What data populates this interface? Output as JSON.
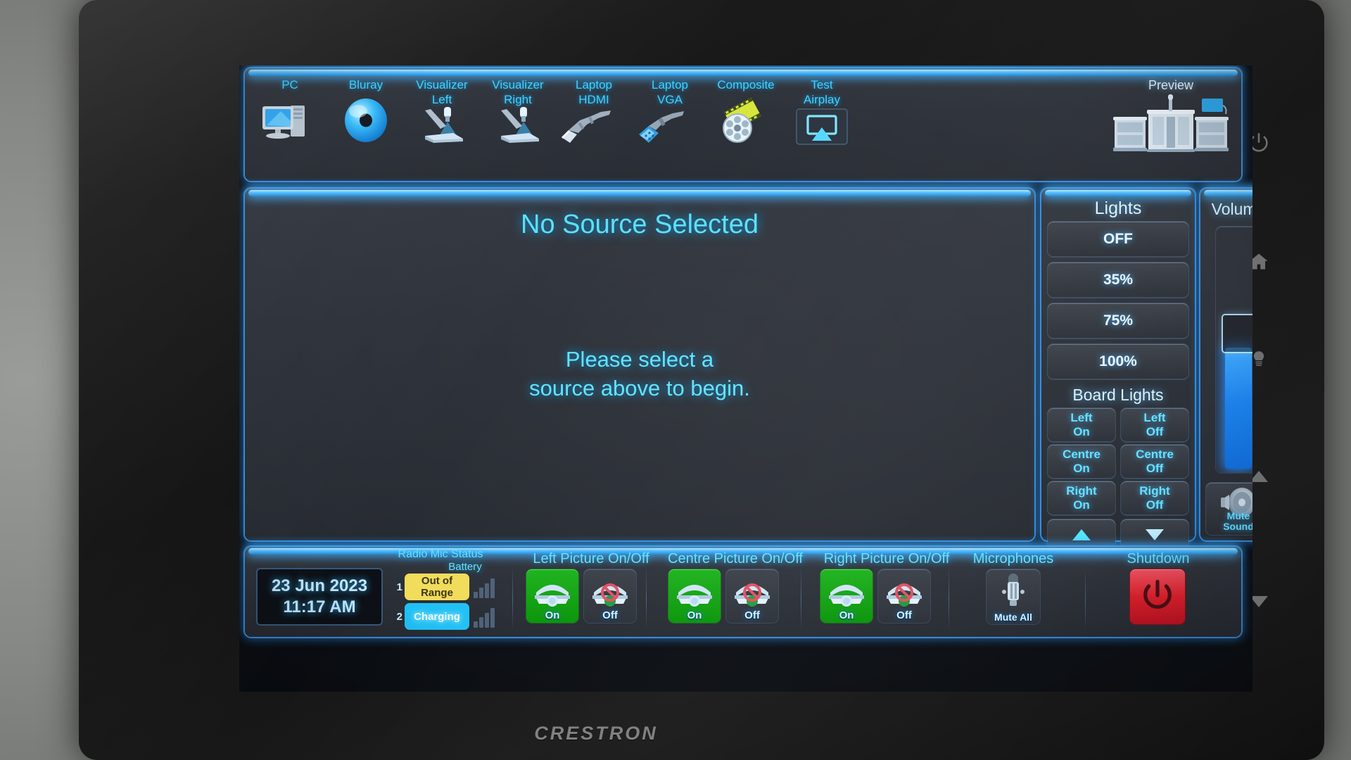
{
  "device": {
    "brand": "CRESTRON"
  },
  "hardware_buttons": [
    {
      "name": "power",
      "icon": "power-icon"
    },
    {
      "name": "home",
      "icon": "home-icon"
    },
    {
      "name": "lights",
      "icon": "lightbulb-icon"
    },
    {
      "name": "volume-up",
      "icon": "triangle-up-icon"
    },
    {
      "name": "volume-down",
      "icon": "triangle-down-icon"
    }
  ],
  "source_bar": {
    "sources": [
      {
        "label": "PC",
        "label2": "",
        "icon": "desktop-computer-icon"
      },
      {
        "label": "Bluray",
        "label2": "",
        "icon": "optical-disc-icon"
      },
      {
        "label": "Visualizer",
        "label2": "Left",
        "icon": "document-camera-icon"
      },
      {
        "label": "Visualizer",
        "label2": "Right",
        "icon": "document-camera-icon"
      },
      {
        "label": "Laptop",
        "label2": "HDMI",
        "icon": "hdmi-cable-icon"
      },
      {
        "label": "Laptop",
        "label2": "VGA",
        "icon": "vga-cable-icon"
      },
      {
        "label": "Composite",
        "label2": "",
        "icon": "film-reel-icon"
      },
      {
        "label": "Test",
        "label2": "Airplay",
        "icon": "airplay-icon"
      }
    ],
    "preview": {
      "label": "Preview",
      "icon": "lectern-preview-icon"
    }
  },
  "main_display": {
    "heading": "No Source Selected",
    "message_line1": "Please select a",
    "message_line2": "source above to begin."
  },
  "lights": {
    "title": "Lights",
    "levels": [
      "OFF",
      "35%",
      "75%",
      "100%"
    ],
    "board_title": "Board Lights",
    "board_buttons": [
      {
        "on": "Left\nOn",
        "off": "Left\nOff"
      },
      {
        "on": "Centre\nOn",
        "off": "Centre\nOff"
      },
      {
        "on": "Right\nOn",
        "off": "Right\nOff"
      }
    ],
    "board_rows": [
      {
        "on_l1": "Left",
        "on_l2": "On",
        "off_l1": "Left",
        "off_l2": "Off"
      },
      {
        "on_l1": "Centre",
        "on_l2": "On",
        "off_l1": "Centre",
        "off_l2": "Off"
      },
      {
        "on_l1": "Right",
        "on_l2": "On",
        "off_l1": "Right",
        "off_l2": "Off"
      }
    ],
    "raise_icon": "triangle-up-icon",
    "lower_icon": "triangle-down-icon"
  },
  "volume": {
    "title": "Volume",
    "level_percent": 48,
    "mute_line1": "Mute",
    "mute_line2": "Sound",
    "mute_icon": "speaker-icon",
    "fill_color": "#1a82f0"
  },
  "bottom_bar": {
    "clock": {
      "date": "23 Jun 2023",
      "time": "11:17 AM"
    },
    "radio_mic": {
      "title": "Radio Mic Status",
      "battery_label": "Battery",
      "channels": [
        {
          "number": "1",
          "status": "Out of Range",
          "status_line1": "Out of",
          "status_line2": "Range",
          "bg_color": "#f2dc5a",
          "text_color": "#3a3412",
          "battery_bars": 4
        },
        {
          "number": "2",
          "status": "Charging",
          "status_line1": "Charging",
          "status_line2": "",
          "bg_color": "#1fc0f5",
          "text_color": "#eafaff",
          "battery_bars": 4
        }
      ]
    },
    "picture_groups": [
      {
        "title": "Left Picture On/Off",
        "on_label": "On",
        "off_label": "Off",
        "state": "on"
      },
      {
        "title": "Centre Picture On/Off",
        "on_label": "On",
        "off_label": "Off",
        "state": "on"
      },
      {
        "title": "Right Picture On/Off",
        "on_label": "On",
        "off_label": "Off",
        "state": "on"
      }
    ],
    "microphones": {
      "title": "Microphones",
      "button_label": "Mute All",
      "icon": "microphone-icon"
    },
    "shutdown": {
      "title": "Shutdown",
      "icon": "power-icon",
      "color": "#e01e2a"
    }
  },
  "theme": {
    "accent_cyan": "#63e1ff",
    "glow_blue": "#1f86d8",
    "panel_bg": "#2b2f37",
    "screen_bg": "#0a0d12",
    "on_green": "#0f9c0f",
    "shutdown_red": "#e01e2a"
  }
}
